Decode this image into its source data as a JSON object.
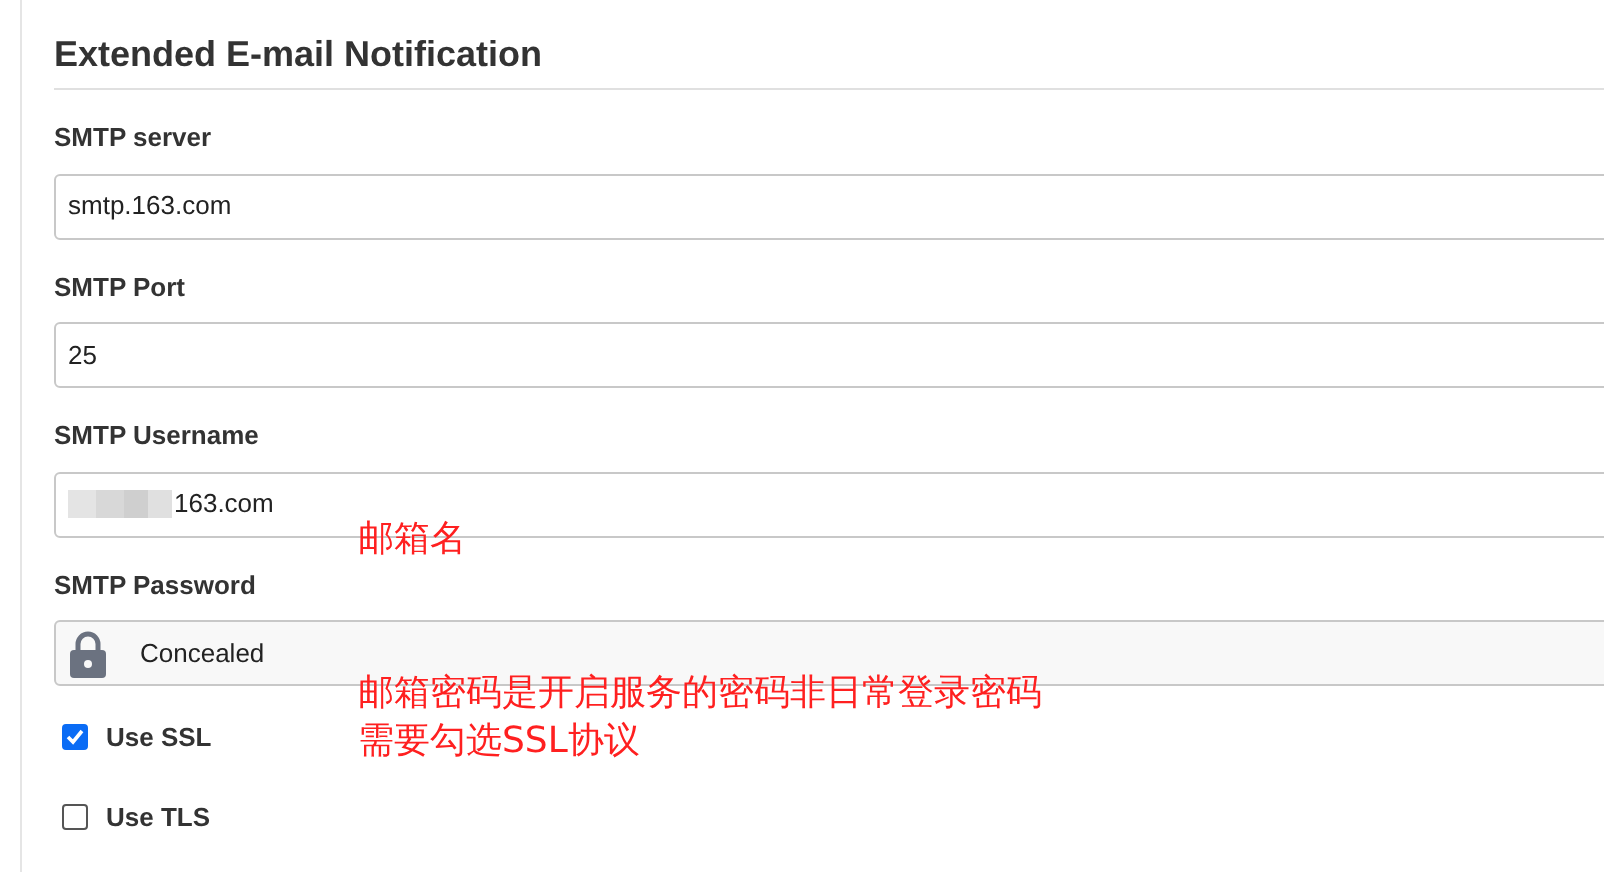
{
  "section": {
    "title": "Extended E-mail Notification"
  },
  "fields": [
    {
      "kind": "text",
      "label": "SMTP server",
      "value": "smtp.163.com",
      "blurred": false
    },
    {
      "kind": "text",
      "label": "SMTP Port",
      "value": "25",
      "blurred": false
    },
    {
      "kind": "text",
      "label": "SMTP Username",
      "value": "163.com",
      "blurred": true
    },
    {
      "kind": "concealed",
      "label": "SMTP Password",
      "value": "Concealed",
      "blurred": false
    }
  ],
  "checkboxes": [
    {
      "label": "Use SSL",
      "checked": true
    },
    {
      "label": "Use TLS",
      "checked": false
    }
  ],
  "annotations": [
    {
      "lines": [
        "邮箱名"
      ]
    },
    {
      "lines": [
        "邮箱密码是开启服务的密码非日常登录密码",
        "需要勾选SSL协议"
      ]
    }
  ]
}
